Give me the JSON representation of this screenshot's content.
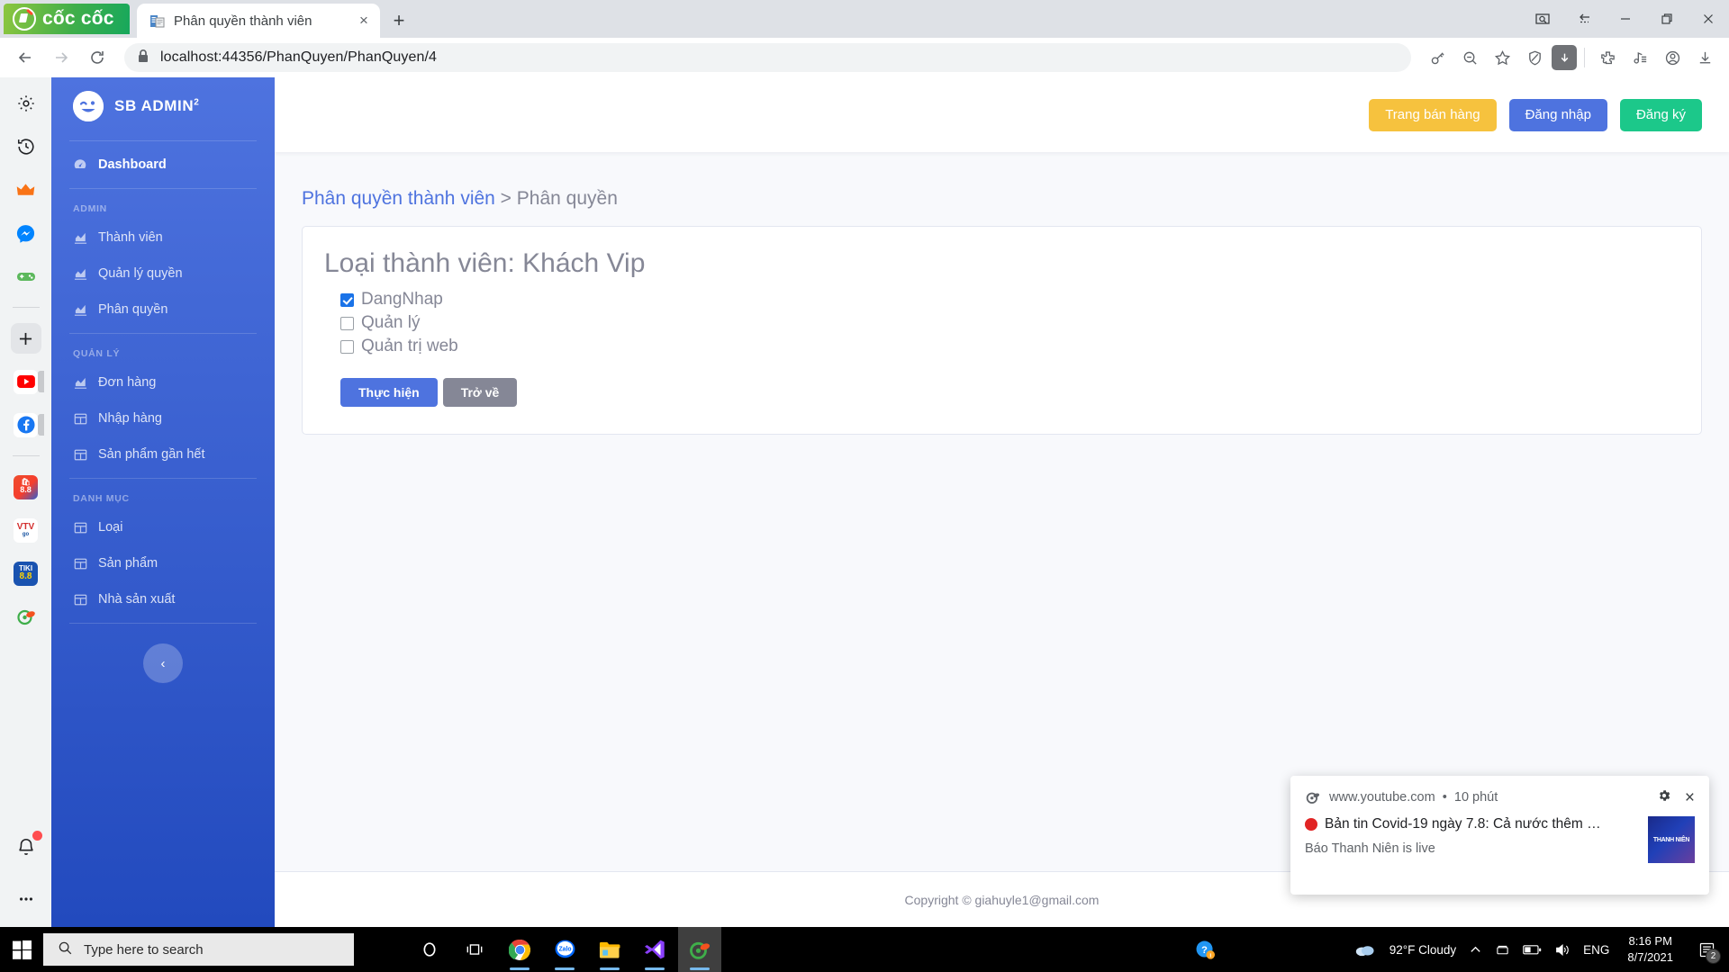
{
  "browser": {
    "logo_text": "cốc cốc",
    "tab": {
      "title": "Phân quyền thành viên",
      "favicon": "document-icon",
      "close": "×"
    },
    "new_tab": "+",
    "window_controls": [
      "screenshot-icon",
      "back-dotted-icon",
      "minimize",
      "maximize",
      "close"
    ],
    "nav": {
      "back": "←",
      "forward": "→",
      "reload": "⟳"
    },
    "omnibox": {
      "lock": "lock-icon",
      "url": "localhost:44356/PhanQuyen/PhanQuyen/4"
    },
    "toolbar_icons": [
      "key-icon",
      "zoom-out-icon",
      "star-icon",
      "shield-icon",
      "download-active-icon",
      "puzzle-icon",
      "music-icon",
      "account-icon",
      "downloads-icon"
    ],
    "sidebar_icons": [
      "gear-icon",
      "history-icon",
      "crown-icon",
      "messenger-icon",
      "game-icon",
      "plus-icon",
      "youtube-icon",
      "facebook-icon",
      "shopee-icon",
      "vtv-icon",
      "tiki-icon",
      "coccoc-icon",
      "bell-icon",
      "more-icon"
    ]
  },
  "sidebar": {
    "brand": "SB ADMIN",
    "brand_sup": "2",
    "dashboard": "Dashboard",
    "headings": {
      "admin": "ADMIN",
      "quanly": "QUẢN LÝ",
      "danhmuc": "DANH MỤC"
    },
    "admin_items": [
      {
        "label": "Thành viên",
        "icon": "chart-icon"
      },
      {
        "label": "Quản lý quyền",
        "icon": "chart-icon"
      },
      {
        "label": "Phân quyền",
        "icon": "chart-icon"
      }
    ],
    "quanly_items": [
      {
        "label": "Đơn hàng",
        "icon": "chart-icon"
      },
      {
        "label": "Nhập hàng",
        "icon": "table-icon"
      },
      {
        "label": "Sản phẩm gần hết",
        "icon": "table-icon"
      }
    ],
    "danhmuc_items": [
      {
        "label": "Loại",
        "icon": "table-icon"
      },
      {
        "label": "Sản phẩm",
        "icon": "table-icon"
      },
      {
        "label": "Nhà sản xuất",
        "icon": "table-icon"
      }
    ],
    "collapse": "‹"
  },
  "topbar": {
    "sell_page": "Trang bán hàng",
    "login": "Đăng nhập",
    "register": "Đăng ký"
  },
  "main": {
    "breadcrumb_link": "Phân quyền thành viên",
    "breadcrumb_sep": " > ",
    "breadcrumb_current": "Phân quyền",
    "card_title": "Loại thành viên: Khách Vip",
    "permissions": [
      {
        "label": "DangNhap",
        "checked": true
      },
      {
        "label": "Quản lý",
        "checked": false
      },
      {
        "label": "Quản trị web",
        "checked": false
      }
    ],
    "submit": "Thực hiện",
    "back": "Trở về",
    "footer": "Copyright © giahuyle1@gmail.com"
  },
  "toast": {
    "source": "www.youtube.com",
    "dot": "•",
    "time": "10 phút",
    "settings_icon": "gear-icon",
    "close_icon": "×",
    "title": "Bản tin Covid-19 ngày 7.8: Cả nước thêm …",
    "subtitle": "Báo Thanh Niên is live",
    "thumb_text": "THANH NIÊN"
  },
  "taskbar": {
    "search_placeholder": "Type here to search",
    "apps": [
      "cortana-icon",
      "taskview-icon",
      "chrome-icon",
      "zalo-icon",
      "explorer-icon",
      "vscode-icon",
      "coccoc-icon"
    ],
    "weather": "92°F  Cloudy",
    "language": "ENG",
    "time": "8:16 PM",
    "date": "8/7/2021",
    "notification_count": "2"
  },
  "colors": {
    "sidebar_top": "#4e73df",
    "sidebar_bottom": "#224abe",
    "yellow": "#f6c23e",
    "green": "#1cc88a",
    "primary": "#4e73df",
    "gray": "#858796"
  }
}
